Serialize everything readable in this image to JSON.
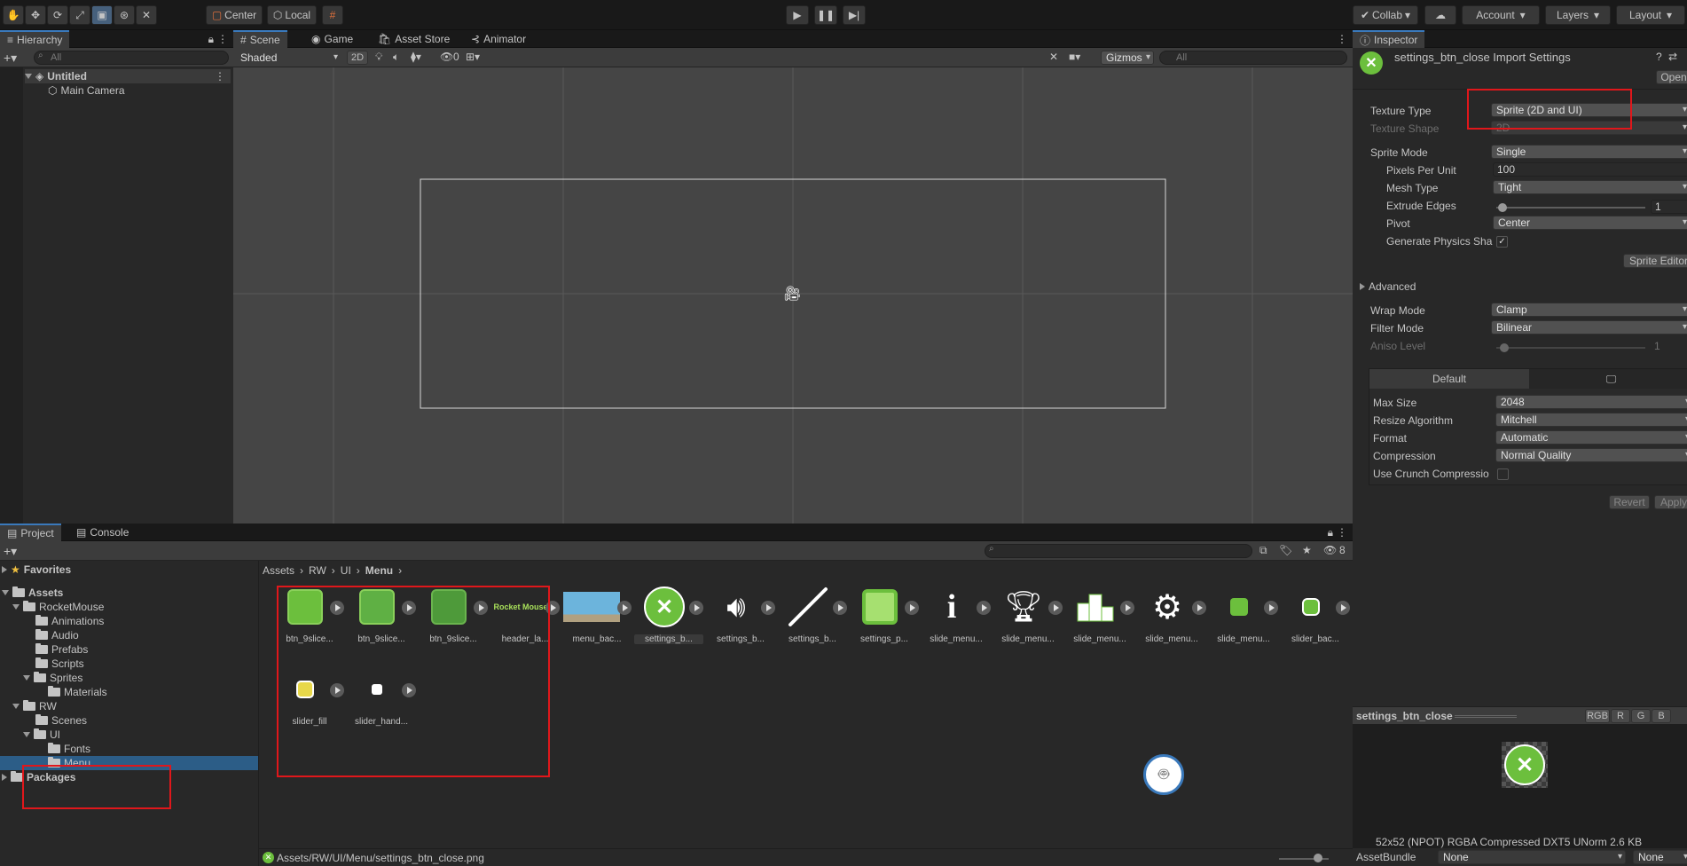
{
  "toolbar": {
    "tools": [
      "hand-tool",
      "move-tool",
      "rotate-tool",
      "scale-tool",
      "rect-tool",
      "transform-tool",
      "custom-tool"
    ],
    "pivot": "Center",
    "space": "Local",
    "collab": "Collab",
    "account": "Account",
    "layers": "Layers",
    "layout": "Layout"
  },
  "hierarchy": {
    "tab": "Hierarchy",
    "search_placeholder": "All",
    "scene": "Untitled",
    "items": [
      "Main Camera"
    ]
  },
  "scene_view": {
    "tabs": [
      "Scene",
      "Game",
      "Asset Store",
      "Animator"
    ],
    "shading": "Shaded",
    "mode_2d": "2D",
    "hidden_count": "0",
    "gizmos": "Gizmos",
    "search_placeholder": "All"
  },
  "project": {
    "tabs": [
      "Project",
      "Console"
    ],
    "hidden_count": "8",
    "favorites": "Favorites",
    "tree": {
      "assets": "Assets",
      "rocketmouse": "RocketMouse",
      "animations": "Animations",
      "audio": "Audio",
      "prefabs": "Prefabs",
      "scripts": "Scripts",
      "sprites": "Sprites",
      "materials": "Materials",
      "rw": "RW",
      "scenes": "Scenes",
      "ui": "UI",
      "fonts": "Fonts",
      "menu": "Menu",
      "packages": "Packages"
    },
    "breadcrumb": [
      "Assets",
      "RW",
      "UI",
      "Menu"
    ],
    "assets": [
      {
        "name": "btn_9slice...",
        "icon": "green-square"
      },
      {
        "name": "btn_9slice...",
        "icon": "green-square"
      },
      {
        "name": "btn_9slice...",
        "icon": "green-square-dark"
      },
      {
        "name": "header_la...",
        "icon": "header-text"
      },
      {
        "name": "menu_bac...",
        "icon": "water-tile"
      },
      {
        "name": "settings_b...",
        "icon": "close-circle"
      },
      {
        "name": "settings_b...",
        "icon": "speaker"
      },
      {
        "name": "settings_b...",
        "icon": "slash-line"
      },
      {
        "name": "settings_p...",
        "icon": "green-panel"
      },
      {
        "name": "slide_menu...",
        "icon": "info"
      },
      {
        "name": "slide_menu...",
        "icon": "trophy"
      },
      {
        "name": "slide_menu...",
        "icon": "podium"
      },
      {
        "name": "slide_menu...",
        "icon": "gear"
      },
      {
        "name": "slide_menu...",
        "icon": "small-square"
      },
      {
        "name": "slider_bac...",
        "icon": "small-circle"
      },
      {
        "name": "slider_fill",
        "icon": "yellow-square"
      },
      {
        "name": "slider_hand...",
        "icon": "white-square"
      }
    ],
    "header_thumb_text": "Rocket Mouse",
    "status_path": "Assets/RW/UI/Menu/settings_btn_close.png"
  },
  "inspector": {
    "tab": "Inspector",
    "title": "settings_btn_close Import Settings",
    "open_button": "Open",
    "rows": {
      "texture_type_label": "Texture Type",
      "texture_type_value": "Sprite (2D and UI)",
      "texture_shape_label": "Texture Shape",
      "texture_shape_value": "2D",
      "sprite_mode_label": "Sprite Mode",
      "sprite_mode_value": "Single",
      "ppu_label": "Pixels Per Unit",
      "ppu_value": "100",
      "mesh_type_label": "Mesh Type",
      "mesh_type_value": "Tight",
      "extrude_label": "Extrude Edges",
      "extrude_value": "1",
      "pivot_label": "Pivot",
      "pivot_value": "Center",
      "physics_label": "Generate Physics Sha",
      "sprite_editor": "Sprite Editor",
      "advanced": "Advanced",
      "wrap_label": "Wrap Mode",
      "wrap_value": "Clamp",
      "filter_label": "Filter Mode",
      "filter_value": "Bilinear",
      "aniso_label": "Aniso Level",
      "aniso_value": "1"
    },
    "platform": {
      "default_tab": "Default",
      "max_size_label": "Max Size",
      "max_size_value": "2048",
      "resize_label": "Resize Algorithm",
      "resize_value": "Mitchell",
      "format_label": "Format",
      "format_value": "Automatic",
      "compression_label": "Compression",
      "compression_value": "Normal Quality",
      "crunch_label": "Use Crunch Compressio"
    },
    "revert": "Revert",
    "apply": "Apply",
    "preview": {
      "name": "settings_btn_close",
      "channels": [
        "RGB",
        "R",
        "G",
        "B"
      ],
      "info": "52x52 (NPOT)  RGBA Compressed DXT5 UNorm  2.6 KB"
    },
    "assetbundle_label": "AssetBundle",
    "assetbundle_value": "None",
    "assetbundle_variant": "None"
  },
  "colors": {
    "accent": "#3a79bb",
    "highlight": "#e0171b",
    "selection": "#2c5d87",
    "green": "#6cbf3d"
  }
}
